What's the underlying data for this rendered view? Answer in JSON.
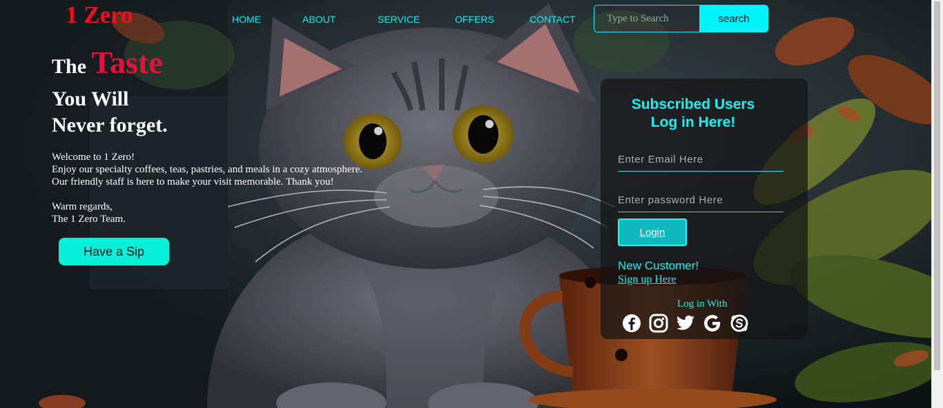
{
  "header": {
    "logo": "1 Zero",
    "nav": [
      "HOME",
      "ABOUT",
      "SERVICE",
      "OFFERS",
      "CONTACT"
    ],
    "search_placeholder": "Type to Search",
    "search_button": "search"
  },
  "hero": {
    "title_prefix": "The",
    "title_accent": "Taste",
    "line2": "You Will",
    "line3": "Never forget.",
    "welcome": "Welcome to 1 Zero!",
    "body1": "Enjoy our specialty coffees, teas, pastries, and meals in a cozy atmosphere.",
    "body2": "Our friendly staff is here to make your visit memorable. Thank you!",
    "regards": "Warm regards,",
    "team": "The 1 Zero Team.",
    "cta": "Have a Sip"
  },
  "login": {
    "title_line1": "Subscribed Users",
    "title_line2": "Log in Here!",
    "email_placeholder": "Enter Email Here",
    "password_placeholder": "Enter password Here",
    "login_button": "Login",
    "new_customer": "New Customer!",
    "signup": "Sign up Here",
    "login_with": "Log in With",
    "socials": [
      "facebook",
      "instagram",
      "twitter",
      "google",
      "skype"
    ]
  },
  "colors": {
    "accent_cyan": "#1cf0f4",
    "logo_red": "#ef0f1f",
    "taste_red": "#e0133d",
    "button_teal": "#08f0d9"
  }
}
